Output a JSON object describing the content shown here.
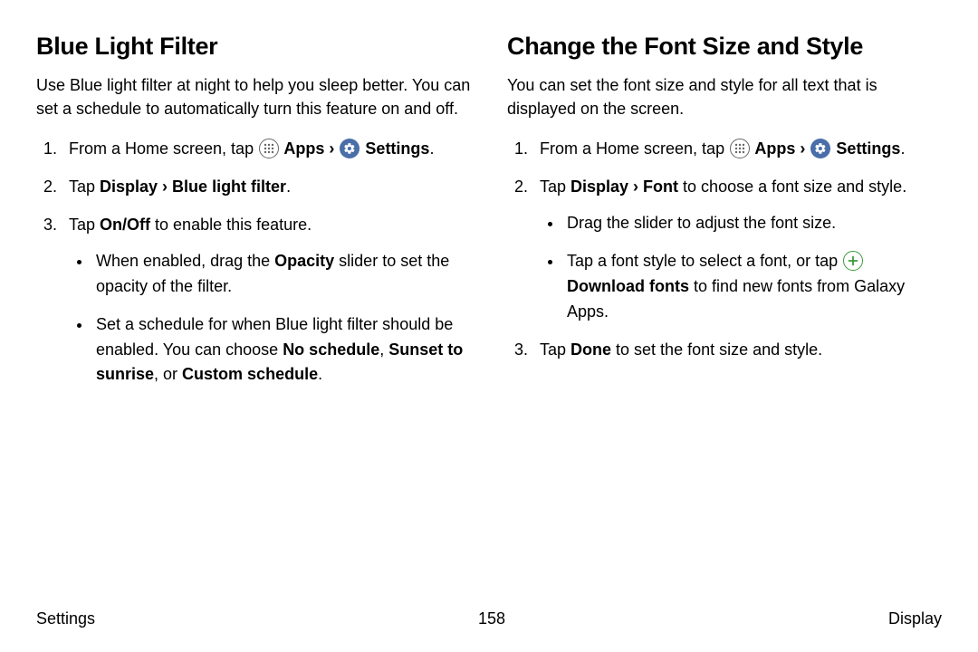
{
  "left": {
    "heading": "Blue Light Filter",
    "intro": "Use Blue light filter at night to help you sleep better. You can set a schedule to automatically turn this feature on and off.",
    "step1_a": "From a Home screen, tap ",
    "step1_apps": " Apps",
    "step1_sep": " › ",
    "step1_settings": " Settings",
    "step1_end": ".",
    "step2_a": "Tap ",
    "step2_b": "Display › Blue light filter",
    "step2_c": ".",
    "step3_a": "Tap ",
    "step3_b": "On/Off",
    "step3_c": " to enable this feature.",
    "sub1_a": "When enabled, drag the ",
    "sub1_b": "Opacity",
    "sub1_c": " slider to set the opacity of the filter.",
    "sub2_a": "Set a schedule for when Blue light filter should be enabled. You can choose ",
    "sub2_b": "No schedule",
    "sub2_c": ", ",
    "sub2_d": "Sunset to sunrise",
    "sub2_e": ", or ",
    "sub2_f": "Custom schedule",
    "sub2_g": "."
  },
  "right": {
    "heading": "Change the Font Size and Style",
    "intro": "You can set the font size and style for all text that is displayed on the screen.",
    "step1_a": "From a Home screen, tap ",
    "step1_apps": " Apps",
    "step1_sep": " › ",
    "step1_settings": " Settings",
    "step1_end": ".",
    "step2_a": "Tap ",
    "step2_b": "Display › Font",
    "step2_c": " to choose a font size and style.",
    "sub1": "Drag the slider to adjust the font size.",
    "sub2_a": "Tap a font style to select a font, or tap ",
    "sub2_b": " Download fonts",
    "sub2_c": " to find new fonts from Galaxy Apps.",
    "step3_a": "Tap ",
    "step3_b": "Done",
    "step3_c": " to set the font size and style."
  },
  "footer": {
    "left": "Settings",
    "center": "158",
    "right": "Display"
  }
}
